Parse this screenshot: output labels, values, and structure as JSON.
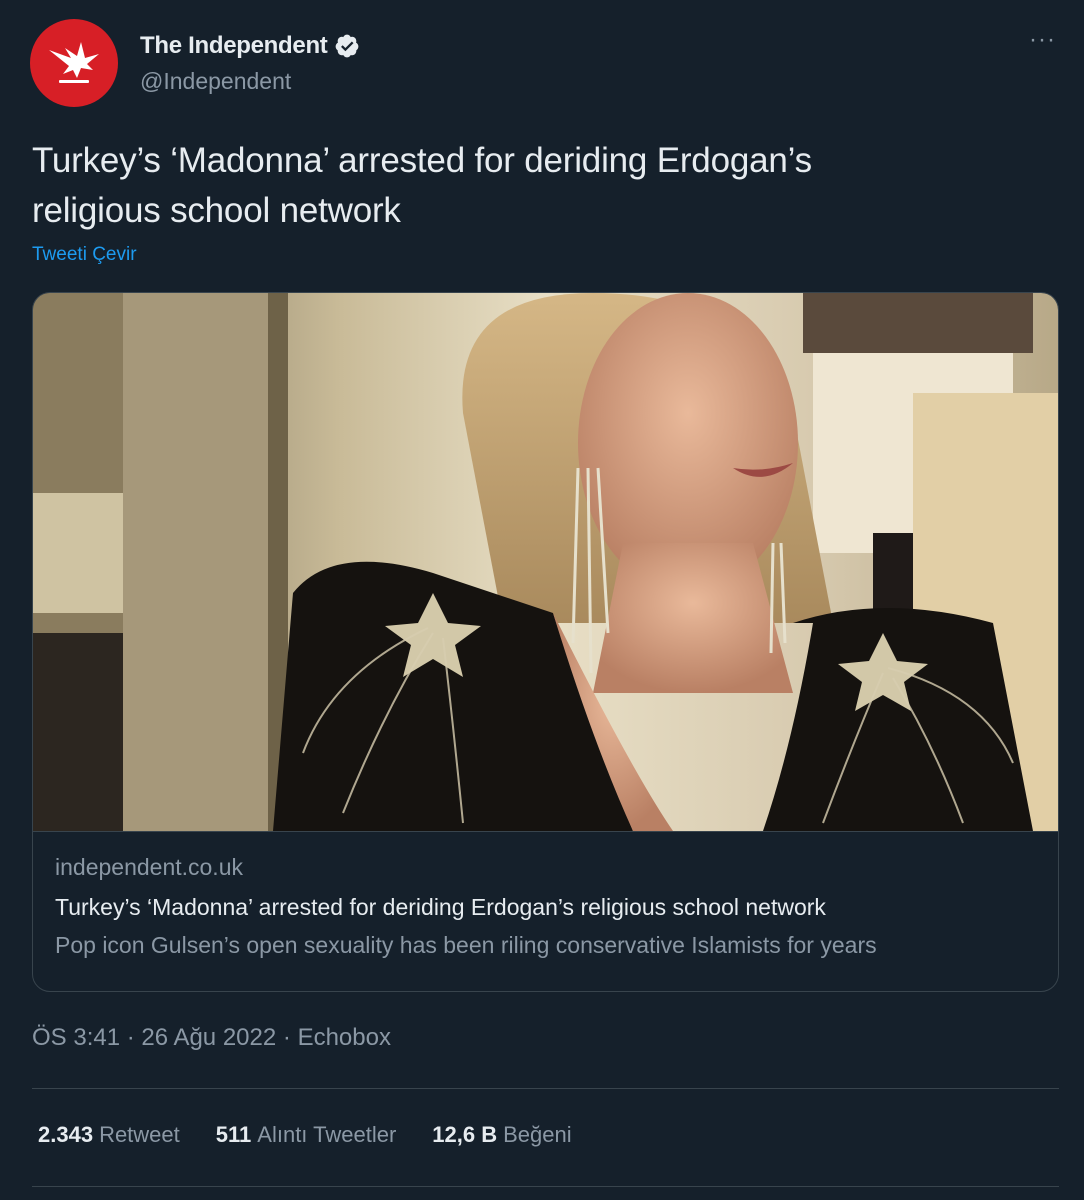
{
  "author": {
    "display_name": "The Independent",
    "handle": "@Independent",
    "verified": true,
    "avatar_icon": "independent-eagle-logo",
    "avatar_color": "#d71f26"
  },
  "more_icon": "···",
  "tweet": {
    "text_line_1": "Turkey’s ‘Madonna’ arrested for deriding Erdogan’s",
    "text_line_2": "religious school network",
    "translate_label": "Tweeti Çevir"
  },
  "card": {
    "image_description_icon": "photo",
    "domain": "independent.co.uk",
    "title": "Turkey’s ‘Madonna’ arrested for deriding Erdogan’s religious school network",
    "description": "Pop icon Gulsen’s open sexuality has been riling conservative Islamists for years"
  },
  "meta": {
    "time": "ÖS 3:41",
    "date": "26 Ağu 2022",
    "source": "Echobox",
    "separator": "·"
  },
  "stats": [
    {
      "count": "2.343",
      "label": "Retweet"
    },
    {
      "count": "511",
      "label": "Alıntı Tweetler"
    },
    {
      "count": "12,6 B",
      "label": "Beğeni"
    }
  ],
  "colors": {
    "background": "#15202b",
    "text_primary": "#e7ecf0",
    "text_secondary": "#8b98a5",
    "link": "#1d9bf0",
    "border": "#38444d",
    "verified": "#e7ecf0"
  }
}
